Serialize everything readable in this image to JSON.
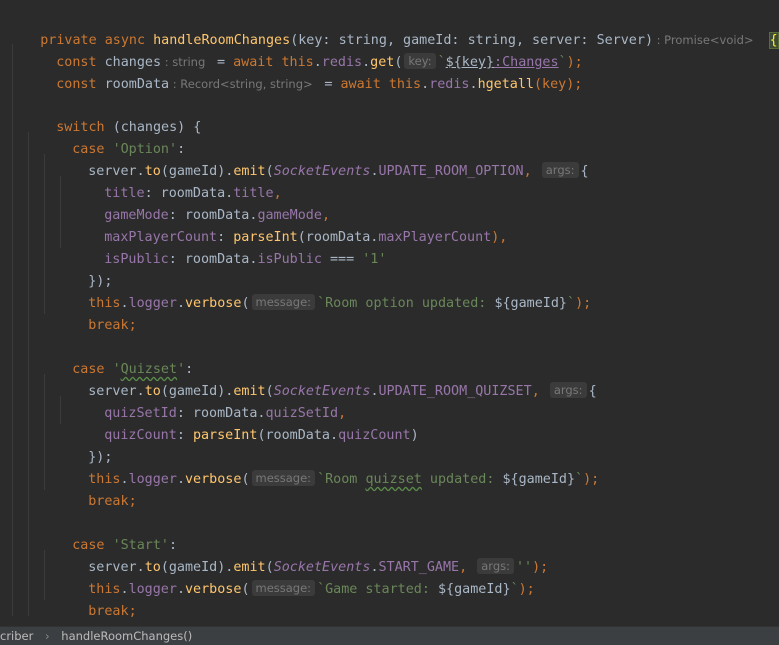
{
  "editor": {
    "l1": {
      "mod": "private async ",
      "name": "handleRoomChanges",
      "p1": "(key: ",
      "t1": "string",
      "p2": ", gameId: ",
      "t2": "string",
      "p3": ", server: ",
      "t3": "Server",
      "p4": ")",
      "ret": " : Promise<void>",
      "brace": "{"
    },
    "l2": {
      "kw": "const ",
      "var": "changes",
      "type": " : string ",
      "eq": " = ",
      "aw": "await ",
      "th": "this",
      "dot1": ".",
      "redis": "redis",
      "dot2": ".",
      "get": "get",
      "op": "(",
      "hint": "key:",
      "tick": "`",
      "interp": "${key}",
      "colon": ":Changes",
      "tickend": "`",
      "close": ");"
    },
    "l3": {
      "kw": "const ",
      "var": "roomData",
      "type": " : Record<string, string> ",
      "eq": " = ",
      "aw": "await ",
      "th": "this",
      "dot1": ".",
      "redis": "redis",
      "dot2": ".",
      "fn": "hgetall",
      "args": "(key);"
    },
    "l5": {
      "kw": "switch ",
      "rest": "(changes) {"
    },
    "l6": {
      "kw": "case ",
      "str": "'Option'",
      "colon": ":"
    },
    "l7": {
      "obj": "server",
      "dot1": ".",
      "to": "to",
      "arg": "(gameId).",
      "emit": "emit",
      "op": "(",
      "cls": "SocketEvents",
      "dot2": ".",
      "ev": "UPDATE_ROOM_OPTION",
      "comma": ",",
      "hint": "args:",
      "brace": "{"
    },
    "l8": {
      "key": "title",
      "colon": ": roomData.",
      "val": "title",
      "comma": ","
    },
    "l9": {
      "key": "gameMode",
      "colon": ": roomData.",
      "val": "gameMode",
      "comma": ","
    },
    "l10": {
      "key": "maxPlayerCount",
      "colon": ": ",
      "fn": "parseInt",
      "op": "(roomData.",
      "val": "maxPlayerCount",
      "close": "),"
    },
    "l11": {
      "key": "isPublic",
      "colon": ": roomData.",
      "val": "isPublic",
      "eq": " === ",
      "str": "'1'"
    },
    "l12": {
      "text": "});"
    },
    "l13": {
      "th": "this",
      "dot1": ".",
      "logger": "logger",
      "dot2": ".",
      "fn": "verbose",
      "op": "(",
      "hint": "message:",
      "str": "`Room option updated: ",
      "interp": "${gameId}",
      "tick": "`",
      "close": ");"
    },
    "l14": {
      "kw": "break",
      "semi": ";"
    },
    "l16": {
      "kw": "case ",
      "q1": "'",
      "str": "Quizset",
      "q2": "'",
      "colon": ":"
    },
    "l17": {
      "obj": "server",
      "dot1": ".",
      "to": "to",
      "arg": "(gameId).",
      "emit": "emit",
      "op": "(",
      "cls": "SocketEvents",
      "dot2": ".",
      "ev": "UPDATE_ROOM_QUIZSET",
      "comma": ",",
      "hint": "args:",
      "brace": "{"
    },
    "l18": {
      "key": "quizSetId",
      "colon": ": roomData.",
      "val": "quizSetId",
      "comma": ","
    },
    "l19": {
      "key": "quizCount",
      "colon": ": ",
      "fn": "parseInt",
      "op": "(roomData.",
      "val": "quizCount",
      "close": ")"
    },
    "l20": {
      "text": "});"
    },
    "l21": {
      "th": "this",
      "dot1": ".",
      "logger": "logger",
      "dot2": ".",
      "fn": "verbose",
      "op": "(",
      "hint": "message:",
      "s1": "`Room ",
      "squig": "quizset",
      "s2": " updated: ",
      "interp": "${gameId}",
      "tick": "`",
      "close": ");"
    },
    "l22": {
      "kw": "break",
      "semi": ";"
    },
    "l24": {
      "kw": "case ",
      "str": "'Start'",
      "colon": ":"
    },
    "l25": {
      "obj": "server",
      "dot1": ".",
      "to": "to",
      "arg": "(gameId).",
      "emit": "emit",
      "op": "(",
      "cls": "SocketEvents",
      "dot2": ".",
      "ev": "START_GAME",
      "comma": ",",
      "hint": "args:",
      "str": "''",
      "close": ");"
    },
    "l26": {
      "th": "this",
      "dot1": ".",
      "logger": "logger",
      "dot2": ".",
      "fn": "verbose",
      "op": "(",
      "hint": "message:",
      "str": "`Game started: ",
      "interp": "${gameId}",
      "tick": "`",
      "close": ");"
    },
    "l27": {
      "kw": "break",
      "semi": ";"
    },
    "l28": {
      "text": "}"
    }
  },
  "breadcrumb": {
    "first": "criber",
    "sep": "›",
    "second": "handleRoomChanges()"
  }
}
